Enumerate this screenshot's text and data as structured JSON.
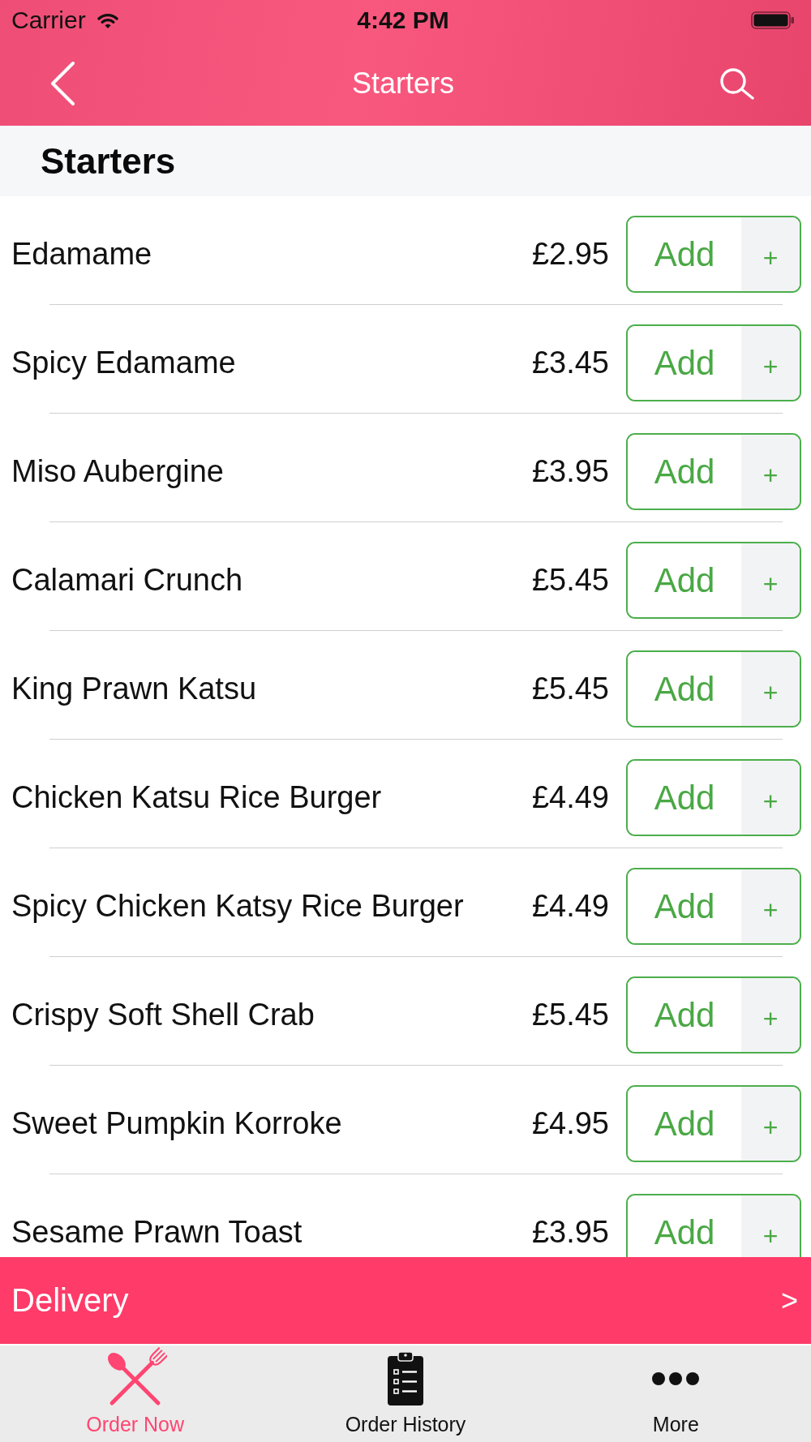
{
  "status_bar": {
    "carrier": "Carrier",
    "time": "4:42 PM"
  },
  "nav_bar": {
    "title": "Starters"
  },
  "section": {
    "title": "Starters"
  },
  "items": [
    {
      "name": "Edamame",
      "price": "£2.95",
      "button": "Add",
      "plus": "+"
    },
    {
      "name": "Spicy Edamame",
      "price": "£3.45",
      "button": "Add",
      "plus": "+"
    },
    {
      "name": "Miso Aubergine",
      "price": "£3.95",
      "button": "Add",
      "plus": "+"
    },
    {
      "name": "Calamari Crunch",
      "price": "£5.45",
      "button": "Add",
      "plus": "+"
    },
    {
      "name": "King Prawn Katsu",
      "price": "£5.45",
      "button": "Add",
      "plus": "+"
    },
    {
      "name": "Chicken Katsu Rice Burger",
      "price": "£4.49",
      "button": "Add",
      "plus": "+"
    },
    {
      "name": "Spicy Chicken Katsy Rice Burger",
      "price": "£4.49",
      "button": "Add",
      "plus": "+"
    },
    {
      "name": "Crispy Soft Shell Crab",
      "price": "£5.45",
      "button": "Add",
      "plus": "+"
    },
    {
      "name": "Sweet Pumpkin Korroke",
      "price": "£4.95",
      "button": "Add",
      "plus": "+"
    },
    {
      "name": "Sesame Prawn Toast",
      "price": "£3.95",
      "button": "Add",
      "plus": "+"
    }
  ],
  "delivery_bar": {
    "label": "Delivery",
    "arrow": ">"
  },
  "tab_bar": [
    {
      "label": "Order Now",
      "selected": true
    },
    {
      "label": "Order History",
      "selected": false
    },
    {
      "label": "More",
      "selected": false
    }
  ]
}
